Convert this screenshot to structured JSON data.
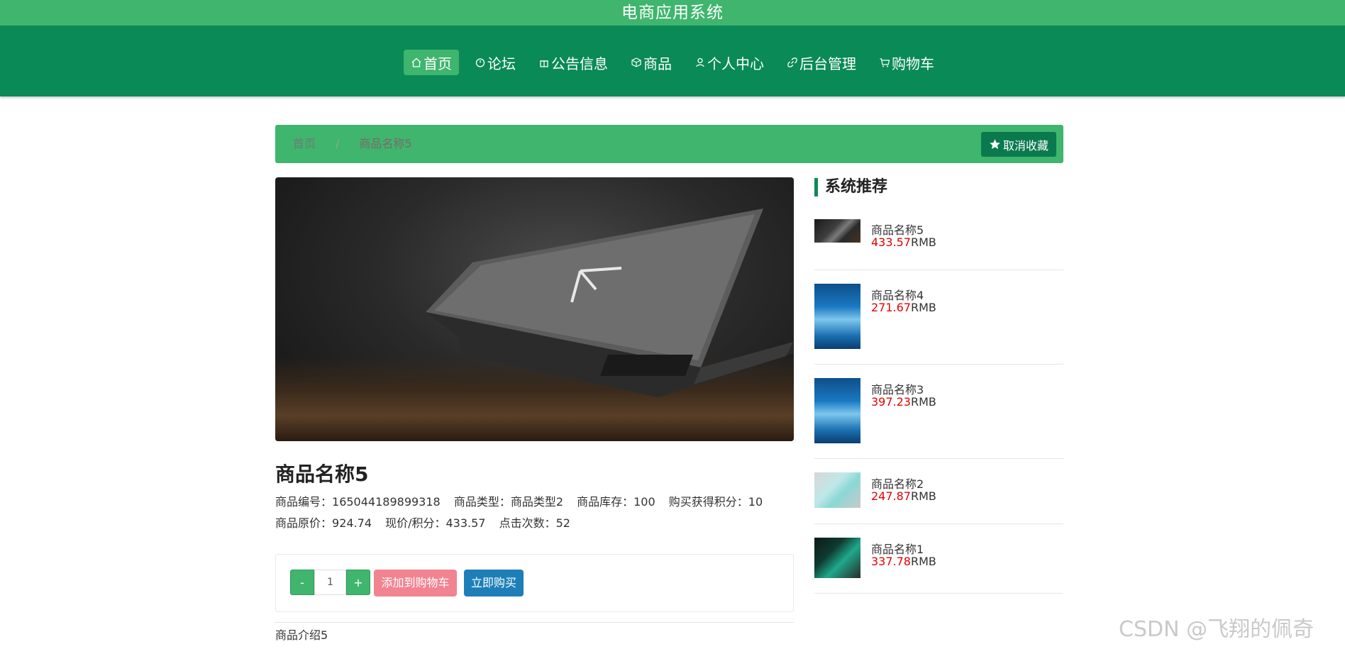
{
  "app": {
    "title": "电商应用系统"
  },
  "nav": {
    "items": [
      {
        "label": "首页",
        "icon": "home-icon",
        "active": true
      },
      {
        "label": "论坛",
        "icon": "clock-icon",
        "active": false
      },
      {
        "label": "公告信息",
        "icon": "gift-icon",
        "active": false
      },
      {
        "label": "商品",
        "icon": "box-icon",
        "active": false
      },
      {
        "label": "个人中心",
        "icon": "user-icon",
        "active": false
      },
      {
        "label": "后台管理",
        "icon": "link-icon",
        "active": false
      },
      {
        "label": "购物车",
        "icon": "cart-icon",
        "active": false
      }
    ]
  },
  "breadcrumb": {
    "home": "首页",
    "separator": "/",
    "current": "商品名称5"
  },
  "favorite": {
    "label": "取消收藏",
    "icon": "star-icon"
  },
  "product": {
    "name": "商品名称5",
    "code_label": "商品编号：",
    "code": "165044189899318",
    "type_label": "商品类型：",
    "type": "商品类型2",
    "stock_label": "商品库存：",
    "stock": "100",
    "points_label": "购买获得积分：",
    "points": "10",
    "orig_price_label": "商品原价：",
    "orig_price": "924.74",
    "price_label": "现价/积分：",
    "price": "433.57",
    "clicks_label": "点击次数：",
    "clicks": "52",
    "intro": "商品介绍5"
  },
  "buy": {
    "minus": "-",
    "plus": "+",
    "quantity": "1",
    "add_cart": "添加到购物车",
    "buy_now": "立即购买"
  },
  "sidebar": {
    "title": "系统推荐",
    "unit": "RMB",
    "items": [
      {
        "name": "商品名称5",
        "price": "433.57",
        "thumb": "laptop-thumb"
      },
      {
        "name": "商品名称4",
        "price": "271.67",
        "thumb": "poster-thumb"
      },
      {
        "name": "商品名称3",
        "price": "397.23",
        "thumb": "poster-thumb"
      },
      {
        "name": "商品名称2",
        "price": "247.87",
        "thumb": "box-thumb"
      },
      {
        "name": "商品名称1",
        "price": "337.78",
        "thumb": "green-thumb"
      }
    ]
  },
  "watermark": "CSDN @飞翔的佩奇",
  "colors": {
    "header": "#3fb56e",
    "nav": "#0a8a57",
    "price": "#e60000",
    "cart_button": "#f28391",
    "buy_button": "#1e7fb8"
  }
}
